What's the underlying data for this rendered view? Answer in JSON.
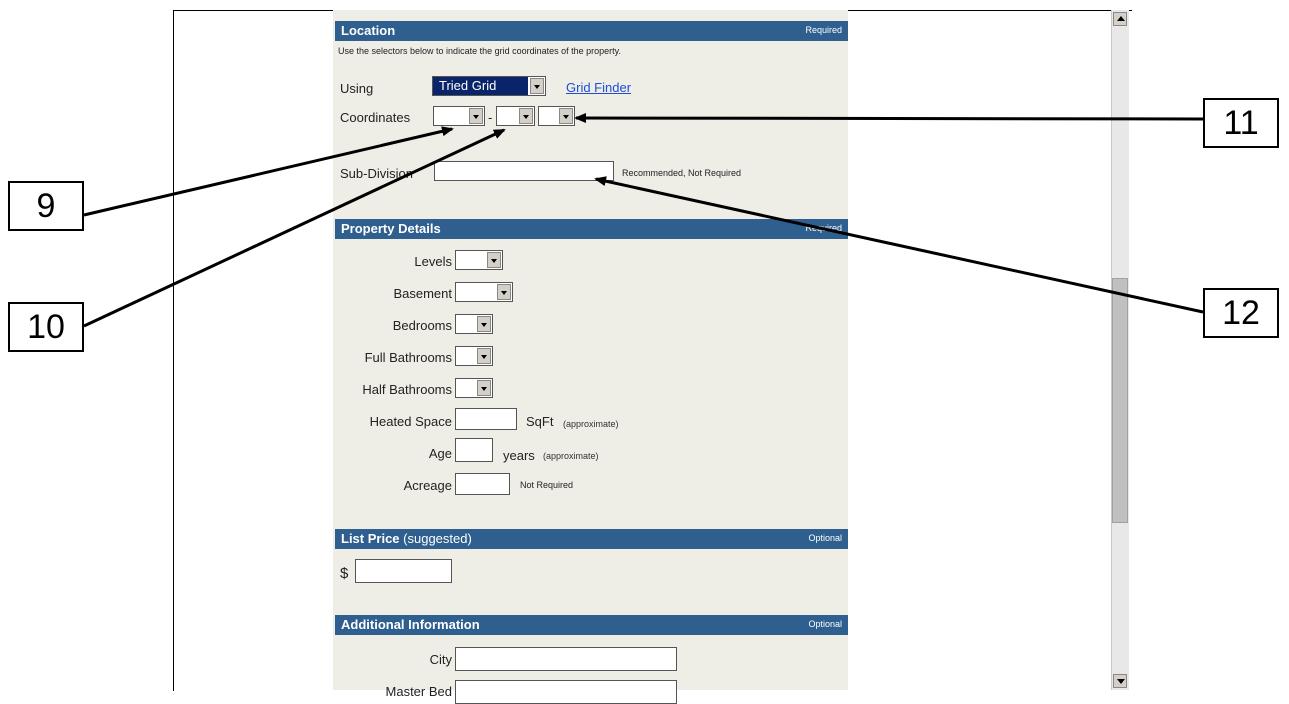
{
  "location": {
    "title": "Location",
    "tag": "Required",
    "help": "Use the selectors below to indicate the grid coordinates of the property.",
    "using_label": "Using",
    "using_value": "Tried Grid",
    "grid_finder": "Grid Finder",
    "coordinates_label": "Coordinates",
    "dash": "-",
    "subdivision_label": "Sub-Division",
    "subdivision_note": "Recommended, Not Required"
  },
  "property": {
    "title": "Property Details",
    "tag": "Required",
    "levels": "Levels",
    "basement": "Basement",
    "bedrooms": "Bedrooms",
    "full_baths": "Full Bathrooms",
    "half_baths": "Half Bathrooms",
    "heated_space": "Heated Space",
    "sqft": "SqFt",
    "approx": "(approximate)",
    "age": "Age",
    "years": "years",
    "acreage": "Acreage",
    "not_required": "Not Required"
  },
  "list_price": {
    "title": "List Price",
    "suffix": "(suggested)",
    "tag": "Optional",
    "currency": "$"
  },
  "additional": {
    "title": "Additional Information",
    "tag": "Optional",
    "city": "City",
    "master_bed": "Master Bed"
  },
  "callouts": {
    "c9": "9",
    "c10": "10",
    "c11": "11",
    "c12": "12"
  }
}
